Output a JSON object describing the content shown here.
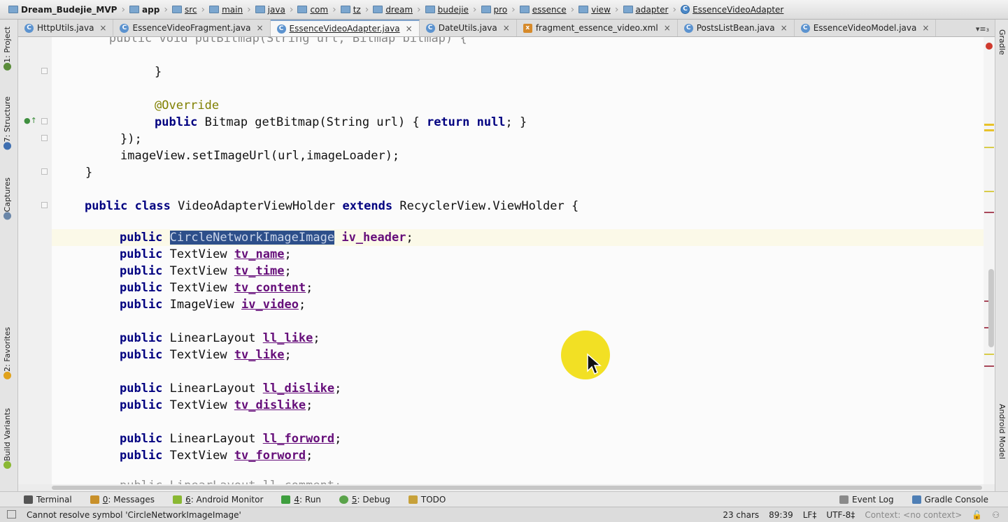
{
  "breadcrumbs": [
    "Dream_Budejie_MVP",
    "app",
    "src",
    "main",
    "java",
    "com",
    "tz",
    "dream",
    "budejie",
    "pro",
    "essence",
    "view",
    "adapter",
    "EssenceVideoAdapter"
  ],
  "tabs": [
    {
      "label": "HttpUtils.java",
      "type": "class",
      "active": false
    },
    {
      "label": "EssenceVideoFragment.java",
      "type": "class",
      "active": false
    },
    {
      "label": "EssenceVideoAdapter.java",
      "type": "class",
      "active": true
    },
    {
      "label": "DateUtils.java",
      "type": "class",
      "active": false
    },
    {
      "label": "fragment_essence_video.xml",
      "type": "xml",
      "active": false
    },
    {
      "label": "PostsListBean.java",
      "type": "class",
      "active": false
    },
    {
      "label": "EssenceVideoModel.java",
      "type": "class",
      "active": false
    }
  ],
  "tab_close": "×",
  "tab_overflow": "▾≡₃",
  "left_tools": {
    "project": "1: Project",
    "structure": "7: Structure",
    "captures": "Captures",
    "favorites": "2: Favorites",
    "build_variants": "Build Variants"
  },
  "right_tools": {
    "gradle": "Gradle",
    "android_model": "Android Model"
  },
  "code": {
    "l0": "        public void putBitmap(String url, Bitmap bitmap) {",
    "l1": "}",
    "l2": "@Override",
    "l3_kw1": "public",
    "l3_rest": " Bitmap getBitmap(String url) ",
    "l3_brace": "{ ",
    "l3_ret": "return null",
    "l3_end": "; }",
    "l4": "});",
    "l5": "imageView.setImageUrl(url,imageLoader);",
    "l6": "}",
    "l7_kw": "public class",
    "l7_name": " VideoAdapterViewHolder ",
    "l7_ext": "extends",
    "l7_rest": " RecyclerView.ViewHolder {",
    "kw_public": "public",
    "f_header_type": "CircleNetworkImageImage",
    "f_header": "iv_header",
    "t_textview": "TextView",
    "t_imageview": "ImageView",
    "t_linear": "LinearLayout",
    "f_name": "tv_name",
    "f_time": "tv_time",
    "f_content": "tv_content",
    "f_video": "iv_video",
    "f_ll_like": "ll_like",
    "f_tv_like": "tv_like",
    "f_ll_dislike": "ll_dislike",
    "f_tv_dislike": "tv_dislike",
    "f_ll_forword": "ll_forword",
    "f_tv_forword": "tv_forword",
    "last_line": "public LinearLayout ll_comment;"
  },
  "bottom_tools": {
    "terminal": "Terminal",
    "messages_num": "0",
    "messages": ": Messages",
    "monitor_num": "6",
    "monitor": ": Android Monitor",
    "run_num": "4",
    "run": ": Run",
    "debug_num": "5",
    "debug": ": Debug",
    "todo": "TODO",
    "event_log": "Event Log",
    "gradle_console": "Gradle Console"
  },
  "status": {
    "message": "Cannot resolve symbol 'CircleNetworkImageImage'",
    "chars": "23 chars",
    "position": "89:39",
    "line_sep": "LF‡",
    "encoding": "UTF-8‡",
    "context": "Context: <no context>"
  },
  "colors": {
    "keyword": "#000080",
    "field": "#660e7a",
    "annotation": "#808000",
    "selection": "#2d4f8a",
    "caret_line": "#fbf9e8",
    "cursor_halo": "#f1de18"
  }
}
